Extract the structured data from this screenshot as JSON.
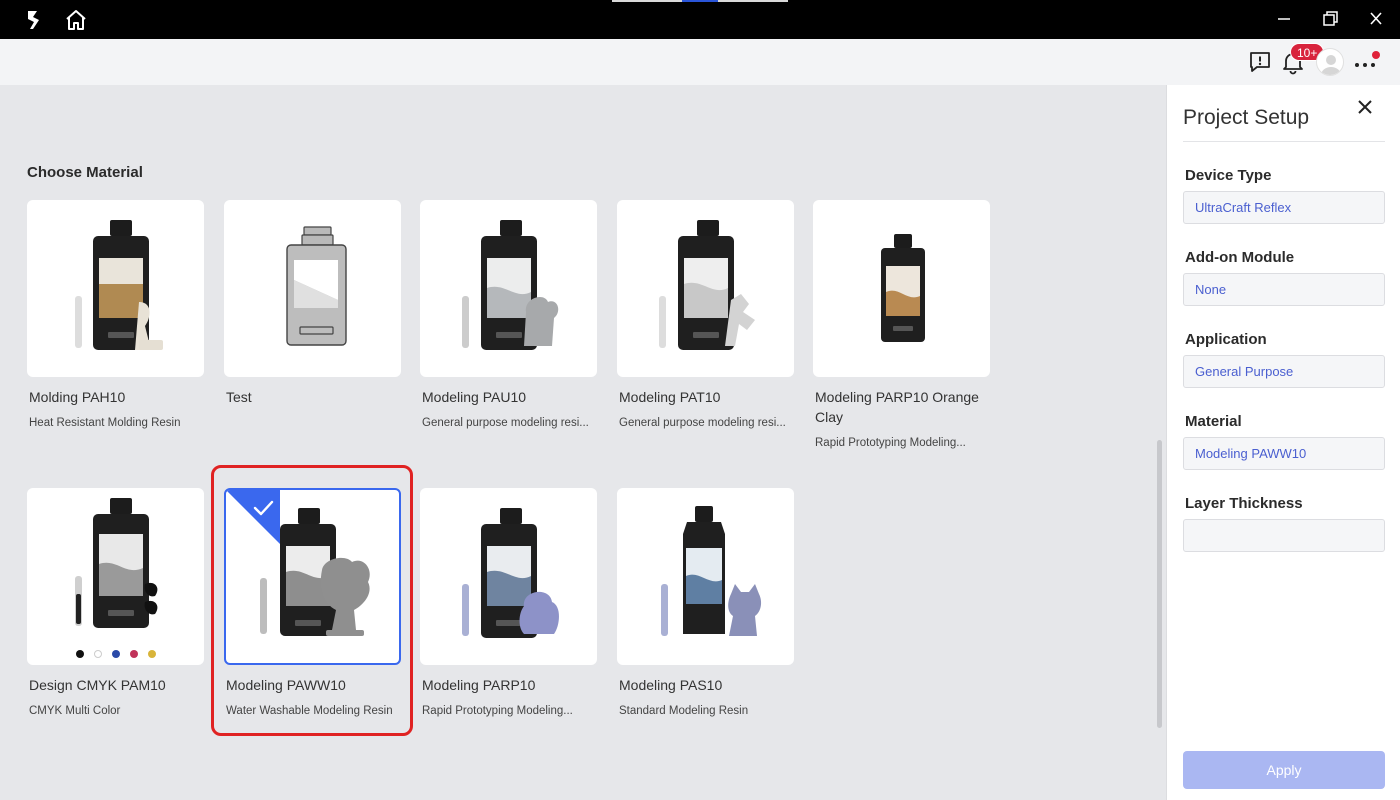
{
  "header": {
    "notification_count": "10+"
  },
  "main": {
    "section_title": "Choose Material",
    "materials": [
      {
        "name": "Molding PAH10",
        "description": "Heat Resistant Molding Resin",
        "selected": false
      },
      {
        "name": "Test",
        "description": "",
        "selected": false
      },
      {
        "name": "Modeling PAU10",
        "description": "General purpose modeling resi...",
        "selected": false
      },
      {
        "name": "Modeling PAT10",
        "description": "General purpose modeling resi...",
        "selected": false
      },
      {
        "name": "Modeling PARP10 Orange Clay",
        "description": "Rapid Prototyping Modeling...",
        "selected": false
      },
      {
        "name": "Design CMYK PAM10",
        "description": "CMYK Multi Color",
        "selected": false
      },
      {
        "name": "Modeling PAWW10",
        "description": "Water Washable Modeling Resin",
        "selected": true
      },
      {
        "name": "Modeling PARP10",
        "description": "Rapid Prototyping Modeling...",
        "selected": false
      },
      {
        "name": "Modeling PAS10",
        "description": "Standard Modeling Resin",
        "selected": false
      }
    ],
    "color_swatches": [
      "#111111",
      "#ffffff",
      "#2a4aa8",
      "#c0335a",
      "#d8b43a"
    ]
  },
  "panel": {
    "title": "Project Setup",
    "fields": [
      {
        "label": "Device Type",
        "value": "UltraCraft Reflex"
      },
      {
        "label": "Add-on Module",
        "value": "None"
      },
      {
        "label": "Application",
        "value": "General Purpose"
      },
      {
        "label": "Material",
        "value": "Modeling PAWW10"
      },
      {
        "label": "Layer Thickness",
        "value": ""
      }
    ],
    "apply_label": "Apply"
  },
  "colors": {
    "accent": "#3a68ee",
    "highlight": "#e02323",
    "badge": "#d8233c",
    "apply_disabled": "#aab7f2",
    "field_text": "#4a5fd0"
  }
}
